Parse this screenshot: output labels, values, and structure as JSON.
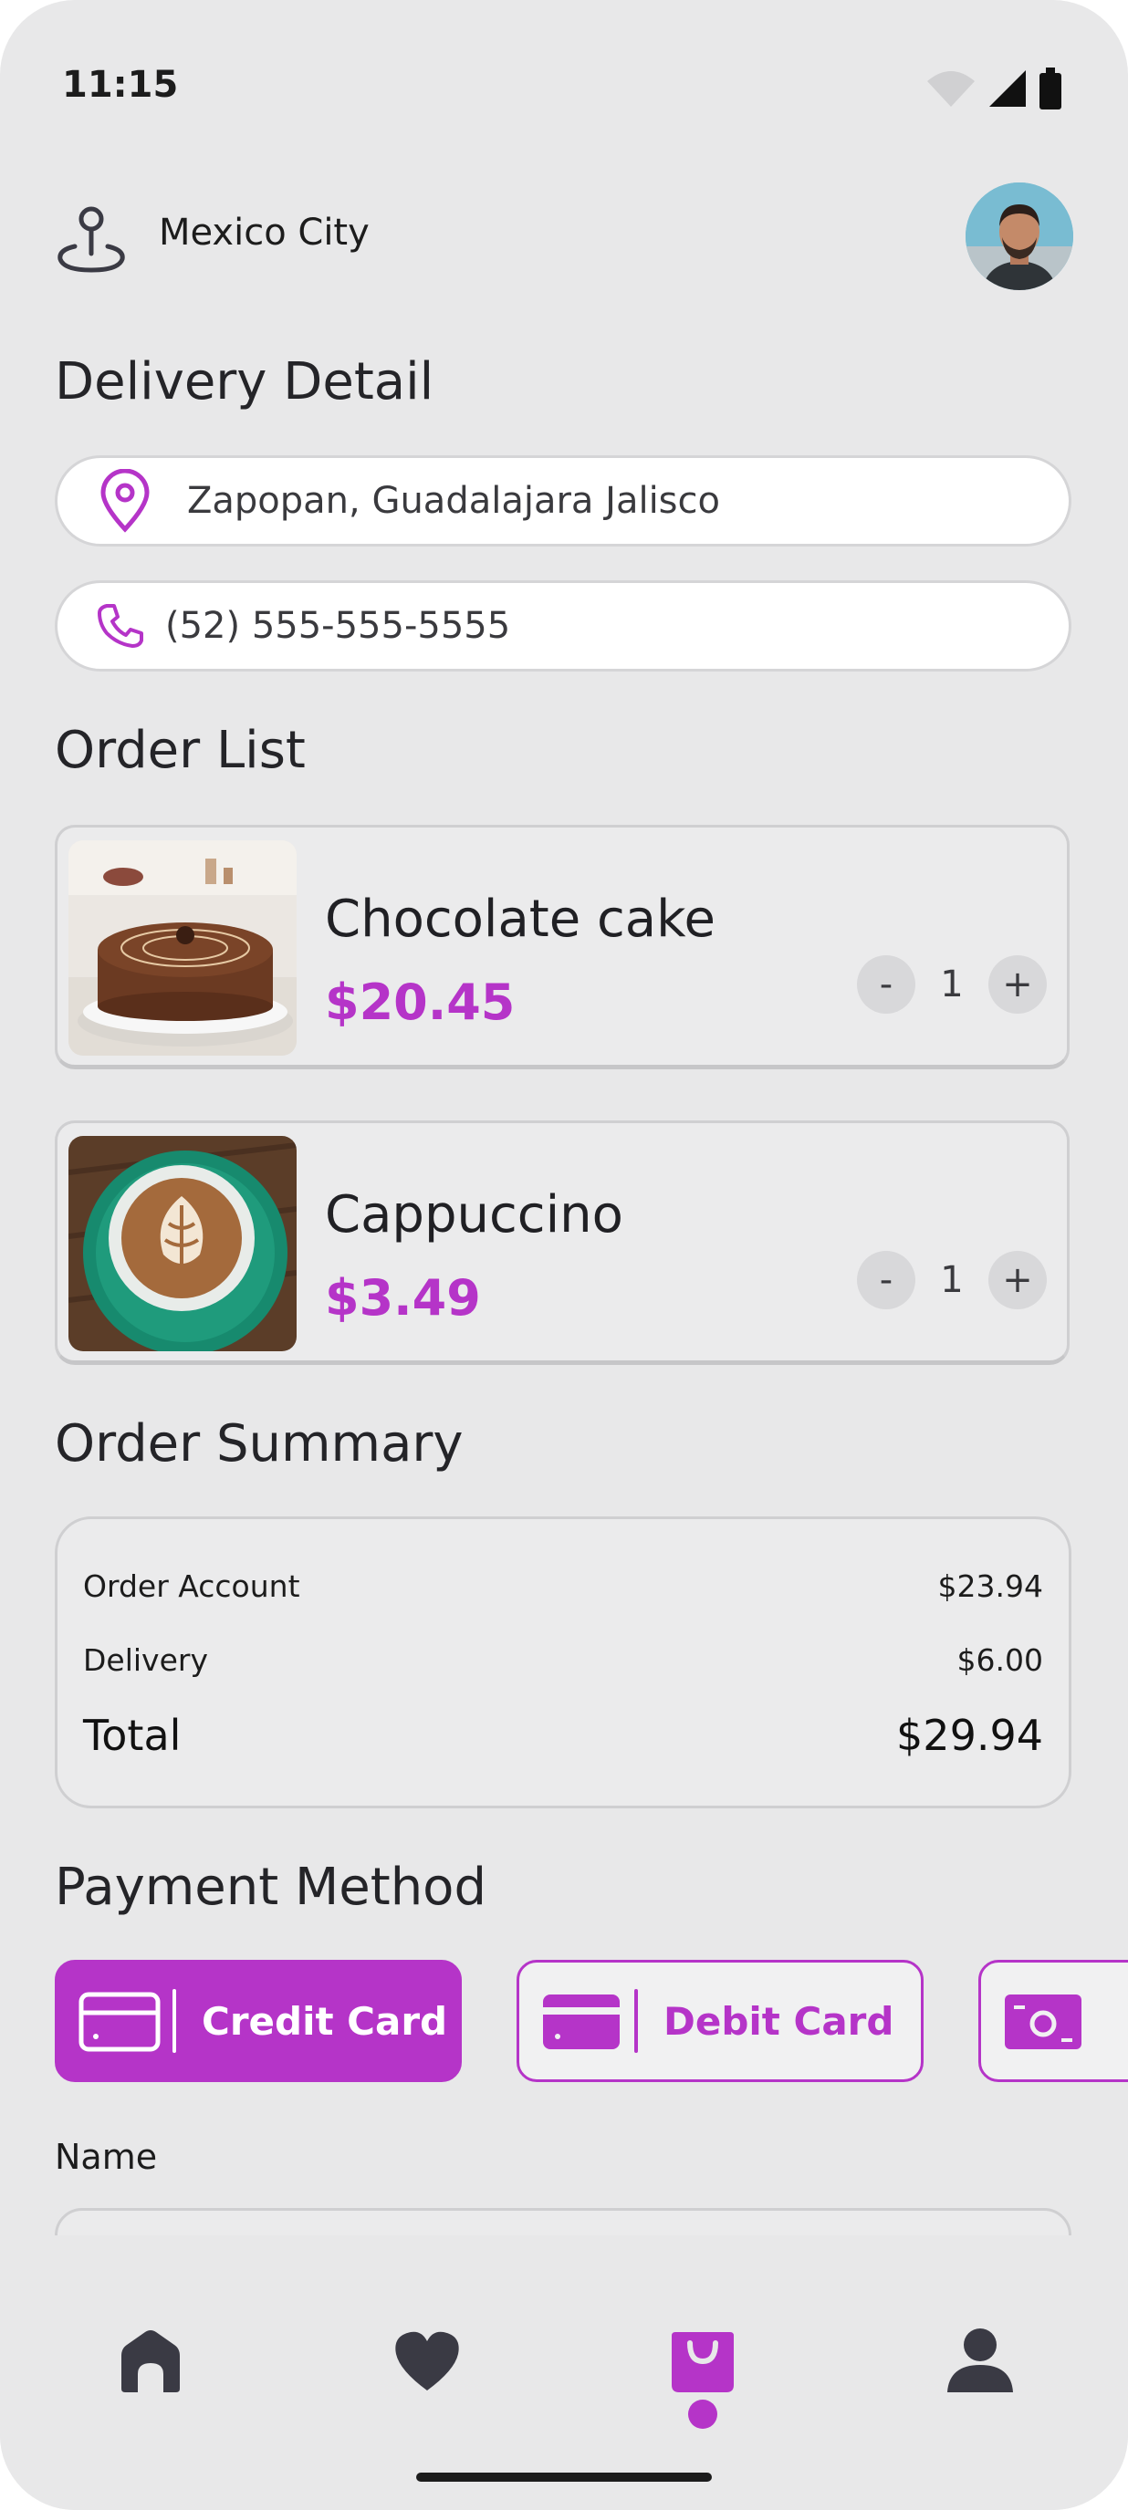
{
  "status": {
    "time": "11:15"
  },
  "header": {
    "city": "Mexico City"
  },
  "delivery": {
    "title": "Delivery Detail",
    "address": "Zapopan, Guadalajara Jalisco",
    "phone": "(52) 555-555-5555"
  },
  "order": {
    "title": "Order List",
    "items": [
      {
        "name": "Chocolate cake",
        "price": "$20.45",
        "qty": "1",
        "minus": "-",
        "plus": "+"
      },
      {
        "name": "Cappuccino",
        "price": "$3.49",
        "qty": "1",
        "minus": "-",
        "plus": "+"
      }
    ]
  },
  "summary": {
    "title": "Order Summary",
    "rows": [
      {
        "label": "Order Account",
        "value": "$23.94"
      },
      {
        "label": "Delivery",
        "value": "$6.00"
      }
    ],
    "total_label": "Total",
    "total_value": "$29.94"
  },
  "payment": {
    "title": "Payment Method",
    "methods": [
      {
        "label": "Credit Card",
        "active": true,
        "icon": "credit-card-icon"
      },
      {
        "label": "Debit Card",
        "active": false,
        "icon": "debit-card-icon"
      },
      {
        "label": "",
        "active": false,
        "icon": "cash-icon"
      }
    ]
  },
  "form": {
    "name_label": "Name"
  },
  "nav": {
    "items": [
      {
        "icon": "home-icon"
      },
      {
        "icon": "heart-icon"
      },
      {
        "icon": "shopping-bag-icon",
        "active": true
      },
      {
        "icon": "user-icon"
      }
    ]
  },
  "colors": {
    "accent": "#b534c8",
    "background": "#e8e8e9",
    "dark_icon": "#3a3a44"
  }
}
